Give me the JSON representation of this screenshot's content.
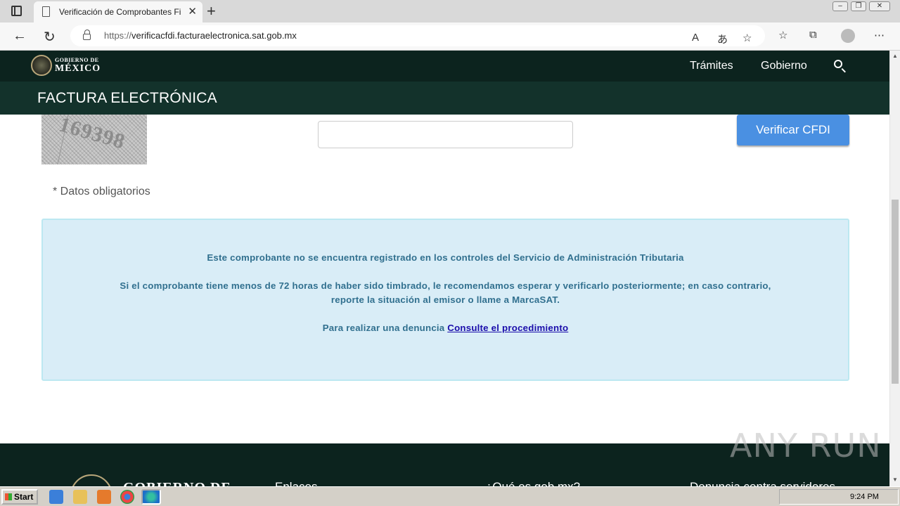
{
  "browser": {
    "tab_title": "Verificación de Comprobantes Fi",
    "url_proto": "https://",
    "url_domain": "verificacfdi.facturaelectronica.sat.gob.mx"
  },
  "header": {
    "gob_line1": "GOBIERNO DE",
    "gob_line2": "MÉXICO",
    "nav": [
      "Trámites",
      "Gobierno"
    ],
    "section_title": "FACTURA ELECTRÓNICA"
  },
  "form": {
    "captcha_text": "169398",
    "verify_button": "Verificar CFDI",
    "required_note": "* Datos obligatorios"
  },
  "alert": {
    "line1": "Este comprobante no se encuentra registrado en los controles del Servicio de Administración Tributaria",
    "line2": "Si el comprobante tiene menos de 72 horas de haber sido timbrado, le recomendamos esperar y verificarlo posteriormente; en caso contrario,",
    "line3": "reporte la situación al emisor o llame a MarcaSAT.",
    "line4_prefix": "Para realizar una denuncia ",
    "line4_link": "Consulte el procedimiento"
  },
  "footer": {
    "gob_text": "GOBIERNO DE",
    "col1": "Enlaces",
    "col2": "¿Qué es gob.mx?",
    "col3": "Denuncia contra servidores"
  },
  "watermark": "ANY RUN",
  "taskbar": {
    "start_label": "Start",
    "clock": "9:24 PM"
  },
  "colors": {
    "gob_dark": "#0c231e",
    "fact_bar": "#13322b",
    "alert_bg": "#d9edf7",
    "alert_text": "#31708f",
    "button": "#4a90e2"
  }
}
